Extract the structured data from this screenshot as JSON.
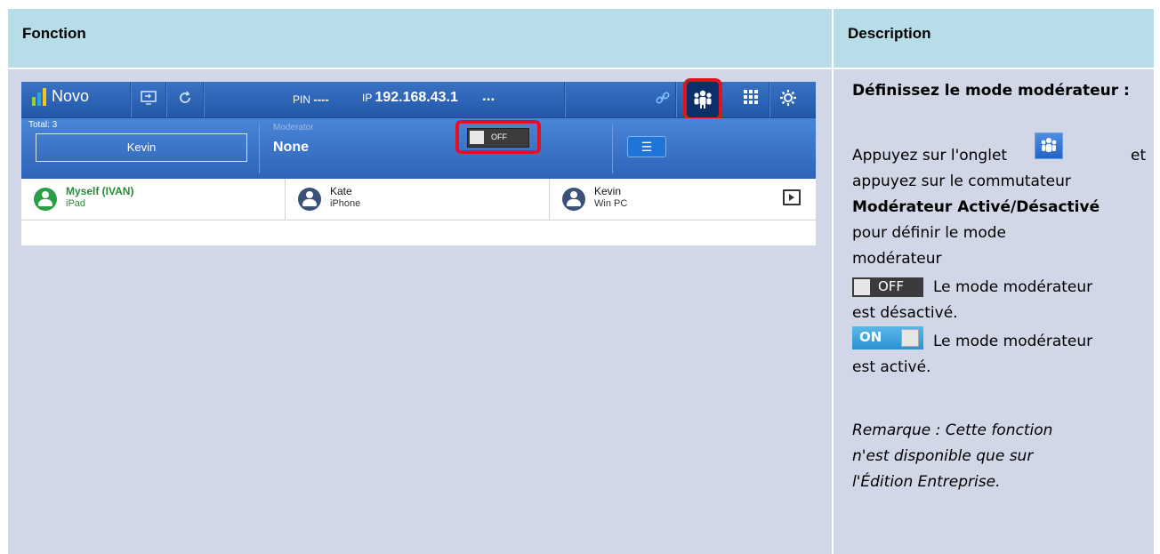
{
  "headers": {
    "function": "Fonction",
    "description": "Description"
  },
  "app": {
    "brand": "Novo",
    "pin_label": "PIN",
    "pin_value": "----",
    "ip_label": "IP",
    "ip_value": "192.168.43.1",
    "ip_more": "...",
    "total": "Total: 3",
    "presenter": "Kevin",
    "moderator_label": "Moderator",
    "moderator_value": "None",
    "toggle_label": "OFF",
    "devices": [
      {
        "name": "Myself (IVAN)",
        "type": "iPad"
      },
      {
        "name": "Kate",
        "type": "iPhone"
      },
      {
        "name": "Kevin",
        "type": "Win PC"
      }
    ]
  },
  "description": {
    "title": "Définissez le mode modérateur :",
    "line1": "Appuyez sur l'onglet",
    "line1_end": "et",
    "line2": "appuyez sur le commutateur",
    "line3": "Modérateur Activé/Désactivé",
    "line4": "pour définir le mode",
    "line5": "modérateur",
    "off_label": "OFF",
    "off_text": "Le mode modérateur",
    "off_text2": "est désactivé.",
    "on_label": "ON",
    "on_text": "Le mode modérateur",
    "on_text2": "est activé.",
    "note1": "Remarque : Cette fonction",
    "note2": "n'est disponible que sur",
    "note3": "l'Édition Entreprise."
  }
}
